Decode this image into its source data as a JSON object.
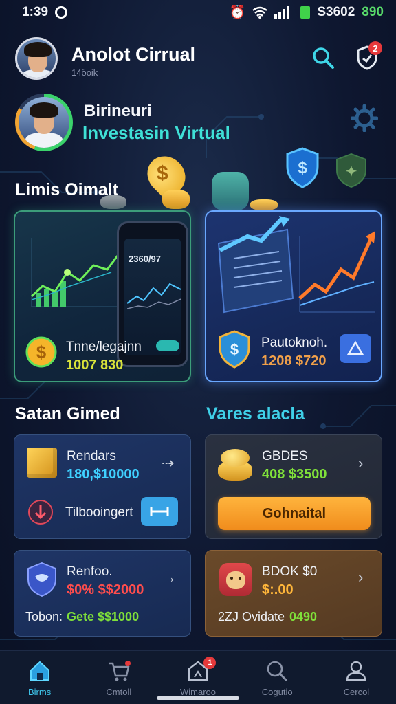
{
  "status_bar": {
    "time": "1:39",
    "right_text": "S3602",
    "right_value": "890"
  },
  "header": {
    "title": "Anolot Cirrual",
    "subtitle": "14öoik",
    "notification_count": "2"
  },
  "profile": {
    "name": "Birineuri",
    "role": "Investasin Virtual"
  },
  "sections": {
    "top": "Limis Oimalt",
    "left": "Satan Gimed",
    "right": "Vares alacla"
  },
  "top_cards": [
    {
      "label": "Tnne/legajnn",
      "value": "1007 830",
      "value_color": "#d8e23a",
      "phone_value": "2360/97"
    },
    {
      "label": "Pautoknoh.",
      "value": "1208 $720",
      "value_color": "#f0a04a"
    }
  ],
  "cards": {
    "box": {
      "label": "Rendars",
      "value": "180,$10000",
      "value_color": "#3fd0ff"
    },
    "tilbooingert": {
      "label": "Tilbooingert"
    },
    "coins": {
      "label": "GBDES",
      "value": "408 $3500",
      "value_color": "#7fe03a",
      "button": "Gohnaital"
    },
    "shield": {
      "label": "Renfoo.",
      "value": "$0% $$2000",
      "value_color": "#ff4d4d",
      "footer_label": "Tobon:",
      "footer_value": "Gete $$1000",
      "footer_color": "#7fe03a"
    },
    "animal": {
      "label": "BDOK $0",
      "value": "$:.00",
      "value_color": "#ffb63a",
      "footer_label": "2ZJ Ovidate",
      "footer_value": "0490",
      "footer_color": "#7fe03a"
    }
  },
  "nav": [
    {
      "label": "Birms",
      "icon": "home-icon",
      "active": true
    },
    {
      "label": "Cmtoll",
      "icon": "cart-icon",
      "active": false
    },
    {
      "label": "Wimaroo",
      "icon": "house-box-icon",
      "active": false,
      "badge": "1"
    },
    {
      "label": "Cogutio",
      "icon": "search-icon",
      "active": false
    },
    {
      "label": "Cercol",
      "icon": "user-icon",
      "active": false
    }
  ]
}
